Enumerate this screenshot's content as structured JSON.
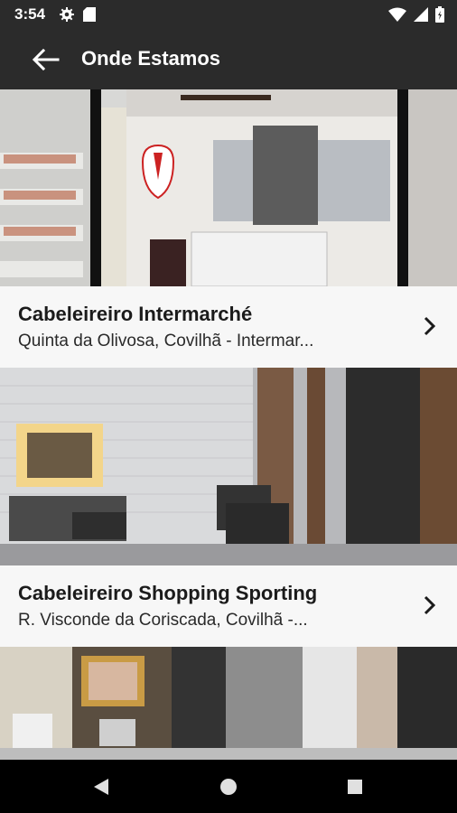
{
  "status_bar": {
    "time": "3:54",
    "left_icons": [
      "gear-icon",
      "sd-card-icon"
    ],
    "right_icons": [
      "wifi-icon",
      "cell-signal-icon",
      "battery-icon"
    ]
  },
  "app_bar": {
    "title": "Onde Estamos"
  },
  "locations": [
    {
      "name": "Cabeleireiro Intermarché",
      "address": "Quinta da Olivosa, Covilhã - Intermar..."
    },
    {
      "name": "Cabeleireiro Shopping Sporting",
      "address": "R. Visconde da Coriscada, Covilhã -..."
    }
  ],
  "nav_bar": {
    "buttons": [
      "back-triangle-icon",
      "home-circle-icon",
      "recents-square-icon"
    ]
  },
  "colors": {
    "bar": "#2b2b2b",
    "card_info_bg": "#f7f7f7",
    "text": "#1b1b1b"
  }
}
